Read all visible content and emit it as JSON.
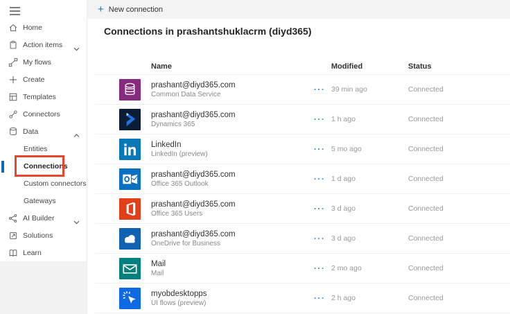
{
  "sidebar": {
    "items": [
      {
        "label": "Home",
        "icon": "home"
      },
      {
        "label": "Action items",
        "icon": "clipboard",
        "expanded": false
      },
      {
        "label": "My flows",
        "icon": "flows"
      },
      {
        "label": "Create",
        "icon": "plus"
      },
      {
        "label": "Templates",
        "icon": "templates"
      },
      {
        "label": "Connectors",
        "icon": "connectors"
      },
      {
        "label": "Data",
        "icon": "database",
        "expanded": true
      },
      {
        "label": "Entities",
        "indent": true
      },
      {
        "label": "Connections",
        "indent": true,
        "selected": true
      },
      {
        "label": "Custom connectors",
        "indent": true
      },
      {
        "label": "Gateways",
        "indent": true
      },
      {
        "label": "AI Builder",
        "icon": "ai-builder",
        "expanded": false
      },
      {
        "label": "Solutions",
        "icon": "solutions"
      },
      {
        "label": "Learn",
        "icon": "learn"
      }
    ]
  },
  "toolbar": {
    "plus_glyph": "+",
    "new_connection_label": "New connection"
  },
  "page": {
    "title": "Connections in prashantshuklacrm (diyd365)"
  },
  "table": {
    "columns": [
      "Name",
      "Modified",
      "Status"
    ],
    "more_options_glyph": "···",
    "rows": [
      {
        "icon": "common-data-service",
        "icon_color": "#862b7e",
        "title": "prashant@diyd365.com",
        "subtitle": "Common Data Service",
        "modified": "39 min ago",
        "status": "Connected"
      },
      {
        "icon": "dynamics-365",
        "icon_color": "#0b1c36",
        "title": "prashant@diyd365.com",
        "subtitle": "Dynamics 365",
        "modified": "1 h ago",
        "status": "Connected"
      },
      {
        "icon": "linkedin",
        "icon_color": "#0a77b6",
        "title": "LinkedIn",
        "subtitle": "LinkedIn (preview)",
        "modified": "5 mo ago",
        "status": "Connected"
      },
      {
        "icon": "office-365-outlook",
        "icon_color": "#0b70c0",
        "title": "prashant@diyd365.com",
        "subtitle": "Office 365 Outlook",
        "modified": "1 d ago",
        "status": "Connected"
      },
      {
        "icon": "office-365-users",
        "icon_color": "#e23e19",
        "title": "prashant@diyd365.com",
        "subtitle": "Office 365 Users",
        "modified": "3 d ago",
        "status": "Connected"
      },
      {
        "icon": "onedrive-for-business",
        "icon_color": "#1262b2",
        "title": "prashant@diyd365.com",
        "subtitle": "OneDrive for Business",
        "modified": "3 d ago",
        "status": "Connected"
      },
      {
        "icon": "mail",
        "icon_color": "#02807e",
        "title": "Mail",
        "subtitle": "Mail",
        "modified": "2 mo ago",
        "status": "Connected"
      },
      {
        "icon": "ui-flows",
        "icon_color": "#0e6ae4",
        "title": "myobdesktopps",
        "subtitle": "UI flows (preview)",
        "modified": "2 h ago",
        "status": "Connected"
      }
    ]
  },
  "colors": {
    "accent": "#0078d4",
    "selection_bar": "#0f6cbd",
    "annotation_highlight": "#e8472b",
    "toolbar_background": "#f3f3f3"
  }
}
